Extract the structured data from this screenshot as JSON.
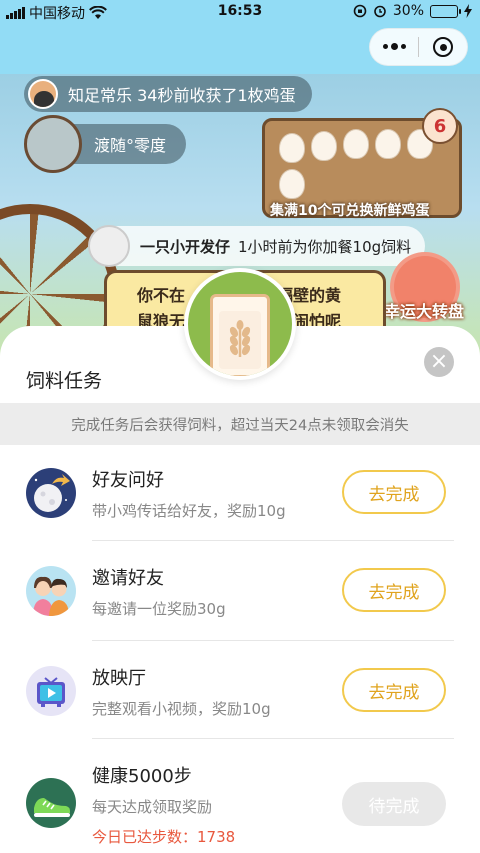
{
  "status_bar": {
    "carrier": "中国移动",
    "time": "16:53",
    "battery_text": "30%"
  },
  "game": {
    "messages": [
      {
        "user": "知足常乐",
        "text": "34秒前收获了1枚鸡蛋"
      },
      {
        "user": "渡随°零度",
        "text": ""
      },
      {
        "user": "一只小开发仔",
        "text": "1小时前为你加餐10g饲料"
      }
    ],
    "egg_count": "6",
    "tray_caption": "集满10个可兑换新鲜鸡蛋",
    "notice_line_1": "你不在",
    "notice_line_1b": "隔壁的黄",
    "notice_line_2": "鼠狼无",
    "notice_line_2b": "闹怕呢",
    "wheel_label": "幸运大转盘"
  },
  "sheet": {
    "title": "饲料任务",
    "close_icon": "×",
    "notice": "完成任务后会获得饲料，超过当天24点未领取会消失",
    "tasks": [
      {
        "name": "好友问好",
        "desc": "带小鸡传话给好友，奖励10g",
        "button": "去完成",
        "icon": "moon-share-icon"
      },
      {
        "name": "邀请好友",
        "desc": "每邀请一位奖励30g",
        "button": "去完成",
        "icon": "friends-icon"
      },
      {
        "name": "放映厅",
        "desc": "完整观看小视频，奖励10g",
        "button": "去完成",
        "icon": "tv-icon"
      },
      {
        "name": "健康5000步",
        "desc": "每天达成领取奖励",
        "extra": "今日已达步数：1738",
        "button": "待完成",
        "icon": "sneaker-icon"
      }
    ]
  },
  "colors": {
    "accent_yellow": "#f2c94c",
    "header_blue": "#92dcf5",
    "steps_red": "#e8583e"
  }
}
